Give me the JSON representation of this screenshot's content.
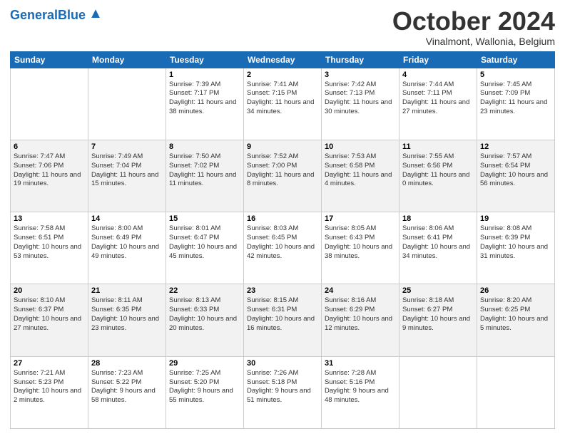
{
  "header": {
    "logo_general": "General",
    "logo_blue": "Blue",
    "month_title": "October 2024",
    "location": "Vinalmont, Wallonia, Belgium"
  },
  "weekdays": [
    "Sunday",
    "Monday",
    "Tuesday",
    "Wednesday",
    "Thursday",
    "Friday",
    "Saturday"
  ],
  "weeks": [
    [
      {
        "day": "",
        "info": ""
      },
      {
        "day": "",
        "info": ""
      },
      {
        "day": "1",
        "info": "Sunrise: 7:39 AM\nSunset: 7:17 PM\nDaylight: 11 hours\nand 38 minutes."
      },
      {
        "day": "2",
        "info": "Sunrise: 7:41 AM\nSunset: 7:15 PM\nDaylight: 11 hours\nand 34 minutes."
      },
      {
        "day": "3",
        "info": "Sunrise: 7:42 AM\nSunset: 7:13 PM\nDaylight: 11 hours\nand 30 minutes."
      },
      {
        "day": "4",
        "info": "Sunrise: 7:44 AM\nSunset: 7:11 PM\nDaylight: 11 hours\nand 27 minutes."
      },
      {
        "day": "5",
        "info": "Sunrise: 7:45 AM\nSunset: 7:09 PM\nDaylight: 11 hours\nand 23 minutes."
      }
    ],
    [
      {
        "day": "6",
        "info": "Sunrise: 7:47 AM\nSunset: 7:06 PM\nDaylight: 11 hours\nand 19 minutes."
      },
      {
        "day": "7",
        "info": "Sunrise: 7:49 AM\nSunset: 7:04 PM\nDaylight: 11 hours\nand 15 minutes."
      },
      {
        "day": "8",
        "info": "Sunrise: 7:50 AM\nSunset: 7:02 PM\nDaylight: 11 hours\nand 11 minutes."
      },
      {
        "day": "9",
        "info": "Sunrise: 7:52 AM\nSunset: 7:00 PM\nDaylight: 11 hours\nand 8 minutes."
      },
      {
        "day": "10",
        "info": "Sunrise: 7:53 AM\nSunset: 6:58 PM\nDaylight: 11 hours\nand 4 minutes."
      },
      {
        "day": "11",
        "info": "Sunrise: 7:55 AM\nSunset: 6:56 PM\nDaylight: 11 hours\nand 0 minutes."
      },
      {
        "day": "12",
        "info": "Sunrise: 7:57 AM\nSunset: 6:54 PM\nDaylight: 10 hours\nand 56 minutes."
      }
    ],
    [
      {
        "day": "13",
        "info": "Sunrise: 7:58 AM\nSunset: 6:51 PM\nDaylight: 10 hours\nand 53 minutes."
      },
      {
        "day": "14",
        "info": "Sunrise: 8:00 AM\nSunset: 6:49 PM\nDaylight: 10 hours\nand 49 minutes."
      },
      {
        "day": "15",
        "info": "Sunrise: 8:01 AM\nSunset: 6:47 PM\nDaylight: 10 hours\nand 45 minutes."
      },
      {
        "day": "16",
        "info": "Sunrise: 8:03 AM\nSunset: 6:45 PM\nDaylight: 10 hours\nand 42 minutes."
      },
      {
        "day": "17",
        "info": "Sunrise: 8:05 AM\nSunset: 6:43 PM\nDaylight: 10 hours\nand 38 minutes."
      },
      {
        "day": "18",
        "info": "Sunrise: 8:06 AM\nSunset: 6:41 PM\nDaylight: 10 hours\nand 34 minutes."
      },
      {
        "day": "19",
        "info": "Sunrise: 8:08 AM\nSunset: 6:39 PM\nDaylight: 10 hours\nand 31 minutes."
      }
    ],
    [
      {
        "day": "20",
        "info": "Sunrise: 8:10 AM\nSunset: 6:37 PM\nDaylight: 10 hours\nand 27 minutes."
      },
      {
        "day": "21",
        "info": "Sunrise: 8:11 AM\nSunset: 6:35 PM\nDaylight: 10 hours\nand 23 minutes."
      },
      {
        "day": "22",
        "info": "Sunrise: 8:13 AM\nSunset: 6:33 PM\nDaylight: 10 hours\nand 20 minutes."
      },
      {
        "day": "23",
        "info": "Sunrise: 8:15 AM\nSunset: 6:31 PM\nDaylight: 10 hours\nand 16 minutes."
      },
      {
        "day": "24",
        "info": "Sunrise: 8:16 AM\nSunset: 6:29 PM\nDaylight: 10 hours\nand 12 minutes."
      },
      {
        "day": "25",
        "info": "Sunrise: 8:18 AM\nSunset: 6:27 PM\nDaylight: 10 hours\nand 9 minutes."
      },
      {
        "day": "26",
        "info": "Sunrise: 8:20 AM\nSunset: 6:25 PM\nDaylight: 10 hours\nand 5 minutes."
      }
    ],
    [
      {
        "day": "27",
        "info": "Sunrise: 7:21 AM\nSunset: 5:23 PM\nDaylight: 10 hours\nand 2 minutes."
      },
      {
        "day": "28",
        "info": "Sunrise: 7:23 AM\nSunset: 5:22 PM\nDaylight: 9 hours\nand 58 minutes."
      },
      {
        "day": "29",
        "info": "Sunrise: 7:25 AM\nSunset: 5:20 PM\nDaylight: 9 hours\nand 55 minutes."
      },
      {
        "day": "30",
        "info": "Sunrise: 7:26 AM\nSunset: 5:18 PM\nDaylight: 9 hours\nand 51 minutes."
      },
      {
        "day": "31",
        "info": "Sunrise: 7:28 AM\nSunset: 5:16 PM\nDaylight: 9 hours\nand 48 minutes."
      },
      {
        "day": "",
        "info": ""
      },
      {
        "day": "",
        "info": ""
      }
    ]
  ]
}
